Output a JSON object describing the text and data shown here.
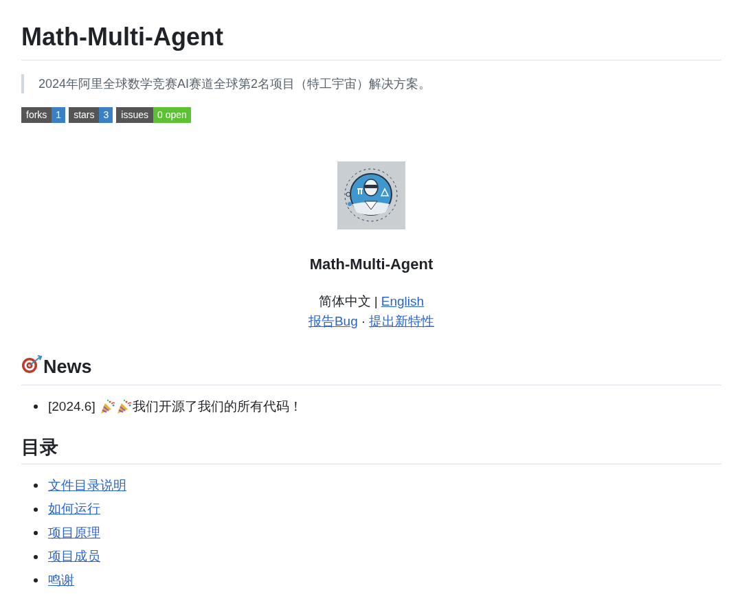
{
  "title": "Math-Multi-Agent",
  "description": "2024年阿里全球数学竞赛AI赛道全球第2名项目（特工宇宙）解决方案。",
  "badges": [
    {
      "label": "forks",
      "value": "1",
      "color": "#3b7fc4"
    },
    {
      "label": "stars",
      "value": "3",
      "color": "#3b7fc4"
    },
    {
      "label": "issues",
      "value": "0 open",
      "color": "#5cc234"
    }
  ],
  "project_name": "Math-Multi-Agent",
  "language_line": {
    "current": "简体中文",
    "separator": "|",
    "link": "English"
  },
  "action_line": {
    "links": [
      "报告Bug",
      "提出新特性"
    ],
    "separator": "·"
  },
  "news": {
    "heading": "News",
    "items": [
      {
        "date": "[2024.6]",
        "text": "我们开源了我们的所有代码！"
      }
    ]
  },
  "toc": {
    "heading": "目录",
    "items": [
      "文件目录说明",
      "如何运行",
      "项目原理",
      "项目成员",
      "鸣谢"
    ]
  }
}
